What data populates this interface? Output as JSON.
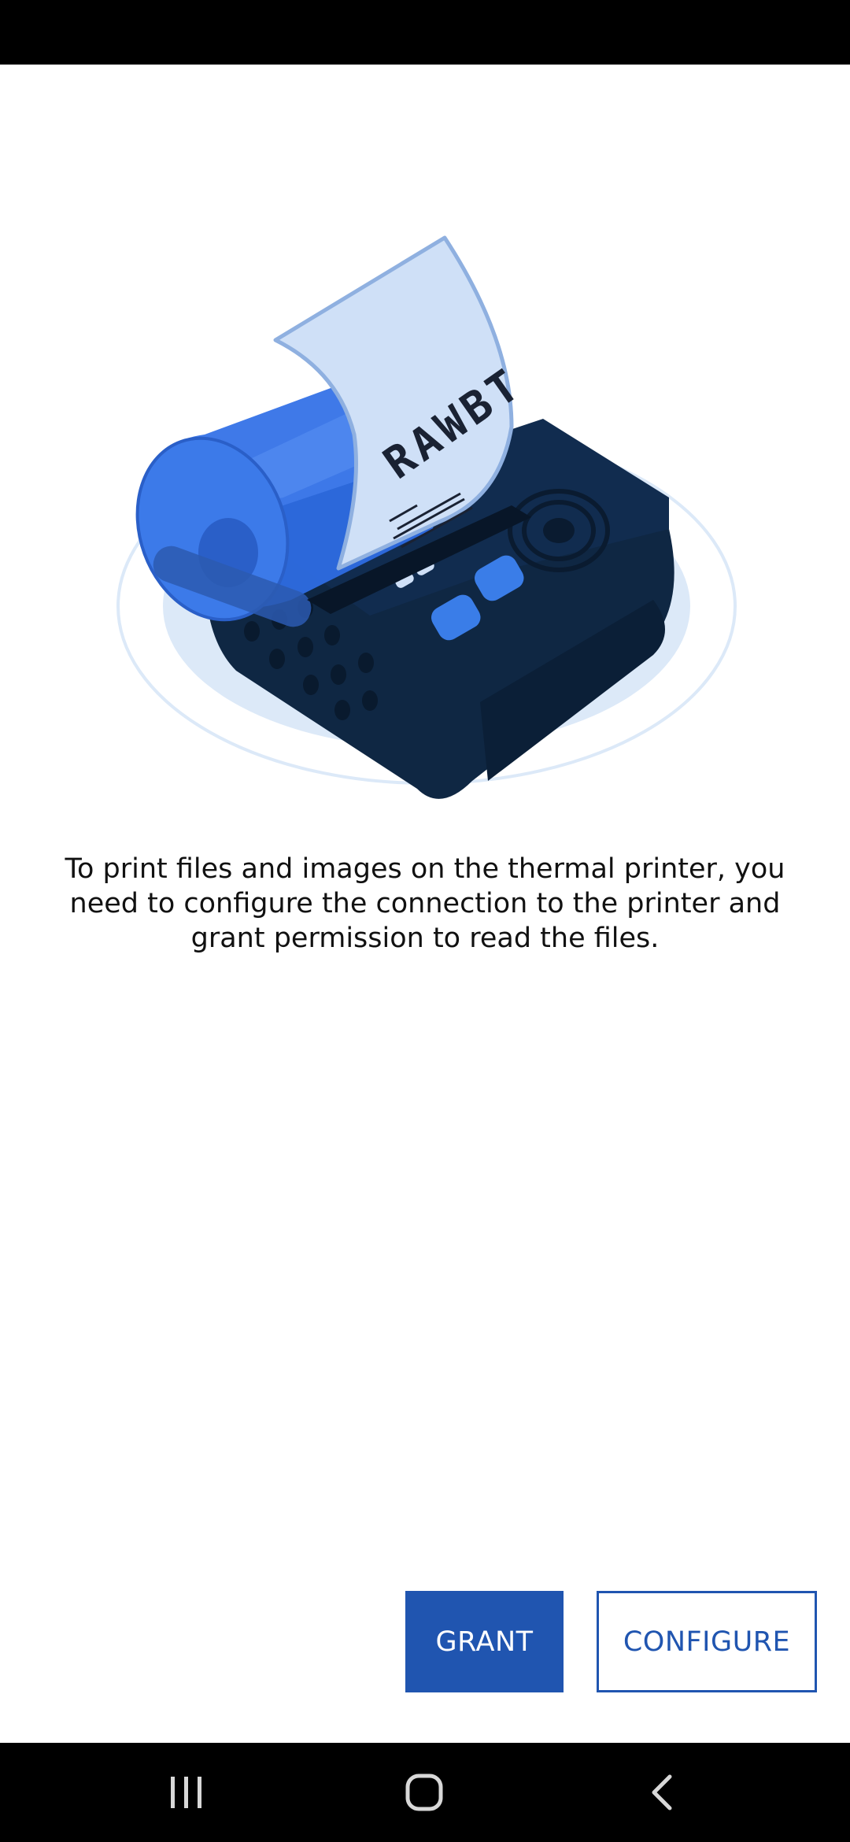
{
  "message": {
    "text": "To print files and images on the thermal printer, you need to configure the connection to the printer and grant permission to read the files."
  },
  "illustration": {
    "receipt_text": "RAWBT",
    "icon": "thermal-printer-illustration"
  },
  "actions": {
    "grant_label": "GRANT",
    "configure_label": "CONFIGURE"
  },
  "nav": {
    "recents_icon": "recents-icon",
    "home_icon": "home-icon",
    "back_icon": "back-icon"
  },
  "colors": {
    "accent": "#2055b0",
    "status_bar": "#000000",
    "nav_bar": "#000000",
    "printer_body": "#10294a",
    "printer_blue": "#2f6ee6",
    "paper": "#cfe0f7",
    "shadow": "#dce9f8"
  }
}
